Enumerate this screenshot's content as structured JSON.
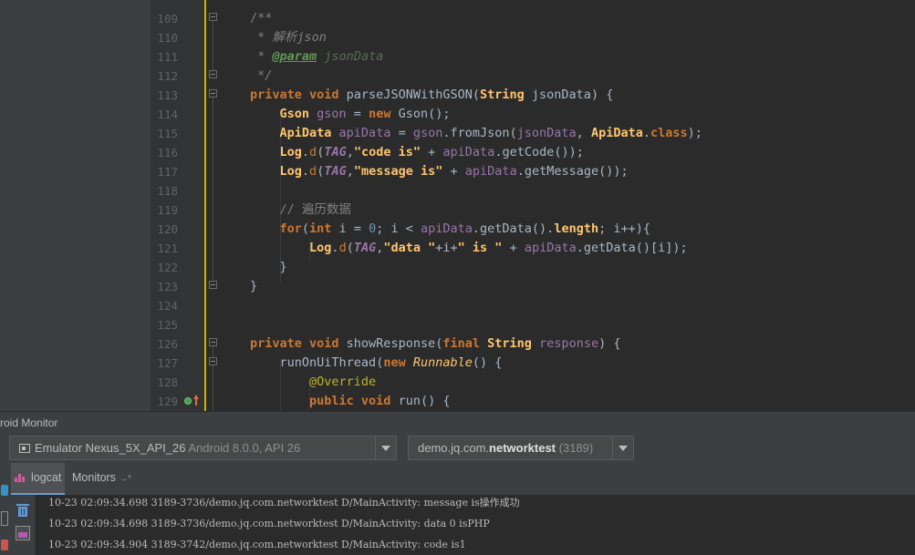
{
  "editor": {
    "line_numbers": [
      "109",
      "110",
      "111",
      "112",
      "113",
      "114",
      "115",
      "116",
      "117",
      "118",
      "119",
      "120",
      "121",
      "122",
      "123",
      "124",
      "125",
      "126",
      "127",
      "128",
      "129"
    ],
    "lines": {
      "l110": {
        "comment": " * 解析json"
      },
      "l111": {
        "tag": "@param",
        "value": "jsonData"
      },
      "l113": {
        "method": "parseJSONWithGSON",
        "param_type": "String",
        "param": "jsonData"
      },
      "l115": {
        "cls_field": "class"
      },
      "l116": {
        "str": "\"code is\"",
        "call": "getCode"
      },
      "l117": {
        "str": "\"message is\"",
        "call": "getMessage"
      },
      "l119": {
        "comment": "// 遍历数据"
      },
      "l121": {
        "str1": "\"data \"",
        "str2": "\" is \""
      },
      "l126": {
        "method": "showResponse",
        "param": "response"
      },
      "l127": {
        "call": "runOnUiThread",
        "type": "Runnable"
      },
      "l128": {
        "annotation": "@Override"
      },
      "l129": {
        "method": "run"
      }
    }
  },
  "monitor": {
    "title": "roid Monitor",
    "device": {
      "name": "Emulator Nexus_5X_API_26",
      "detail": "Android 8.0.0, API 26"
    },
    "process": {
      "prefix": "demo.jq.com.",
      "name": "networktest",
      "pid": "(3189)"
    },
    "tabs": {
      "logcat": "logcat",
      "monitors": "Monitors",
      "monitors_pin": "→*"
    },
    "log_lines": [
      "10-23 02:09:34.698 3189-3736/demo.jq.com.networktest D/MainActivity: message is操作成功",
      "10-23 02:09:34.698 3189-3736/demo.jq.com.networktest D/MainActivity: data 0 isPHP",
      "10-23 02:09:34.904 3189-3742/demo.jq.com.networktest D/MainActivity: code is1"
    ]
  },
  "colors": {
    "editor_bg": "#2b2b2b",
    "keyword": "#cc7832",
    "comment": "#808080",
    "string": "#6a8759",
    "number": "#6897bb",
    "caret_line": "#d0b100"
  }
}
